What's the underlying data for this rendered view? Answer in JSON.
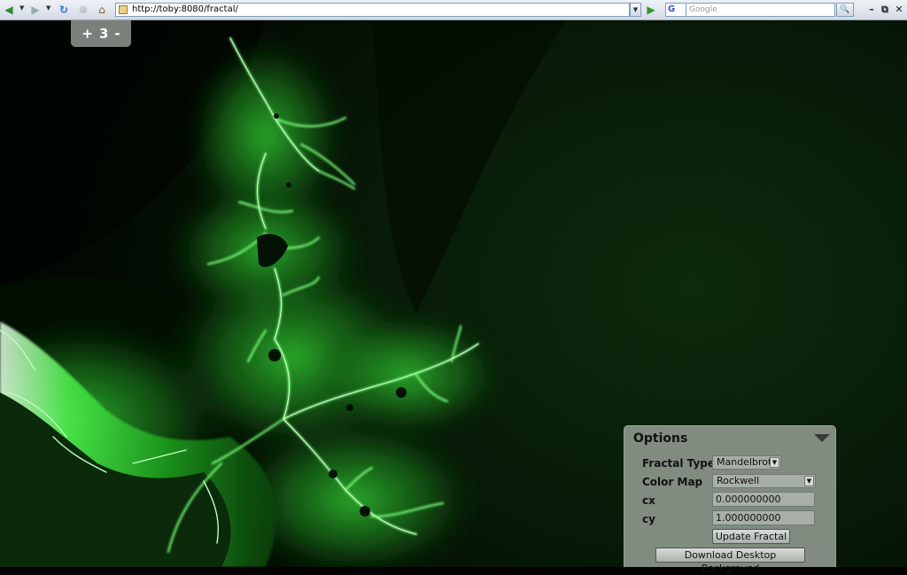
{
  "browser": {
    "url": "http://toby:8080/fractal/",
    "search_placeholder": "Google",
    "search_engine_label": "G",
    "icons": {
      "back": "back-arrow-icon",
      "forward": "forward-arrow-icon",
      "refresh": "refresh-icon",
      "stop": "stop-icon",
      "home": "home-icon",
      "go": "go-arrow-icon",
      "search": "magnifier-icon"
    }
  },
  "zoom": {
    "plus": "+",
    "level": "3",
    "minus": "-"
  },
  "options": {
    "title": "Options",
    "fractal_type_label": "Fractal Type",
    "fractal_type_value": "Mandelbrot",
    "color_map_label": "Color Map",
    "color_map_value": "Rockwell",
    "cx_label": "cx",
    "cx_value": "0.000000000",
    "cy_label": "cy",
    "cy_value": "1.000000000",
    "update_button": "Update Fractal",
    "download_button": "Download Desktop Background"
  },
  "colors": {
    "fractal_bright": "#3cff3c",
    "fractal_mid": "#22b022",
    "fractal_dark": "#0a3a0a",
    "background": "#051205"
  }
}
